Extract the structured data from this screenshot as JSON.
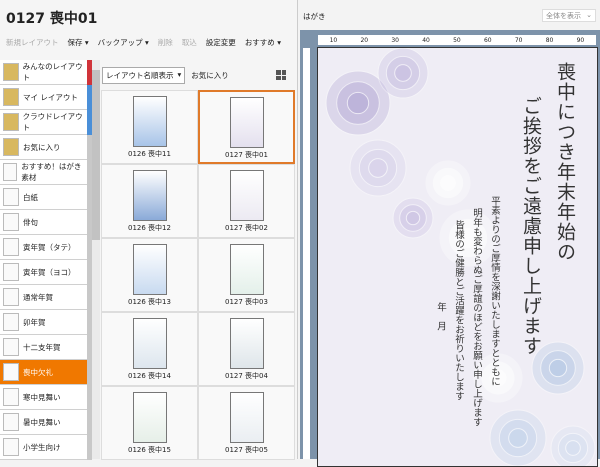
{
  "title": "0127 喪中01",
  "toolbar": {
    "new": "新規レイアウト",
    "save": "保存 ▾",
    "backup": "バックアップ ▾",
    "delete": "削除",
    "import": "取込",
    "settings": "設定変更",
    "recommend": "おすすめ ▾"
  },
  "sidebar": [
    {
      "label": "みんなのレイアウト",
      "strip": "#d0343a"
    },
    {
      "label": "マイ レイアウト",
      "strip": "#4a8fd8"
    },
    {
      "label": "クラウドレイアウト",
      "strip": "#4a8fd8"
    },
    {
      "label": "お気に入り"
    },
    {
      "label": "おすすめ！はがき素材"
    },
    {
      "label": "白紙"
    },
    {
      "label": "俳句"
    },
    {
      "label": "寅年賀（タテ）"
    },
    {
      "label": "寅年賀（ヨコ）"
    },
    {
      "label": "通常年賀"
    },
    {
      "label": "卯年賀"
    },
    {
      "label": "十二支年賀"
    },
    {
      "label": "喪中欠礼",
      "selected": true
    },
    {
      "label": "寒中見舞い"
    },
    {
      "label": "暑中見舞い"
    },
    {
      "label": "小学生向け"
    }
  ],
  "grid": {
    "sort": "レイアウト名順表示",
    "favorite": "お気に入り",
    "items": [
      {
        "label": "0126 喪中11",
        "color": "#a8c4e8"
      },
      {
        "label": "0127 喪中01",
        "color": "#e4e0ee",
        "selected": true
      },
      {
        "label": "0126 喪中12",
        "color": "#8aaad8"
      },
      {
        "label": "0127 喪中02",
        "color": "#eceaf2"
      },
      {
        "label": "0126 喪中13",
        "color": "#c8daf0"
      },
      {
        "label": "0127 喪中03",
        "color": "#e4f0ea"
      },
      {
        "label": "0126 喪中14",
        "color": "#dde6ee"
      },
      {
        "label": "0127 喪中04",
        "color": "#dfe6ea"
      },
      {
        "label": "0126 喪中15",
        "color": "#e6efe8"
      },
      {
        "label": "0127 喪中05",
        "color": "#eaeef2"
      }
    ]
  },
  "preview": {
    "label": "はがき",
    "zoom": "全体を表示",
    "ruler": [
      "10",
      "20",
      "30",
      "40",
      "50",
      "60",
      "70",
      "80",
      "90"
    ],
    "heading1": "喪中につき年末年始の",
    "heading2": "ご挨拶をご遠慮申し上げます",
    "body": [
      "平素よりのご厚情を深謝いたしますとともに",
      "明年も変わらぬご厚誼のほどをお願い申し上げます",
      "皆様のご健勝とご活躍をお祈りいたします"
    ],
    "date": "年　月"
  },
  "colors": {
    "accent": "#f07800",
    "selected_border": "#e07a2a"
  }
}
